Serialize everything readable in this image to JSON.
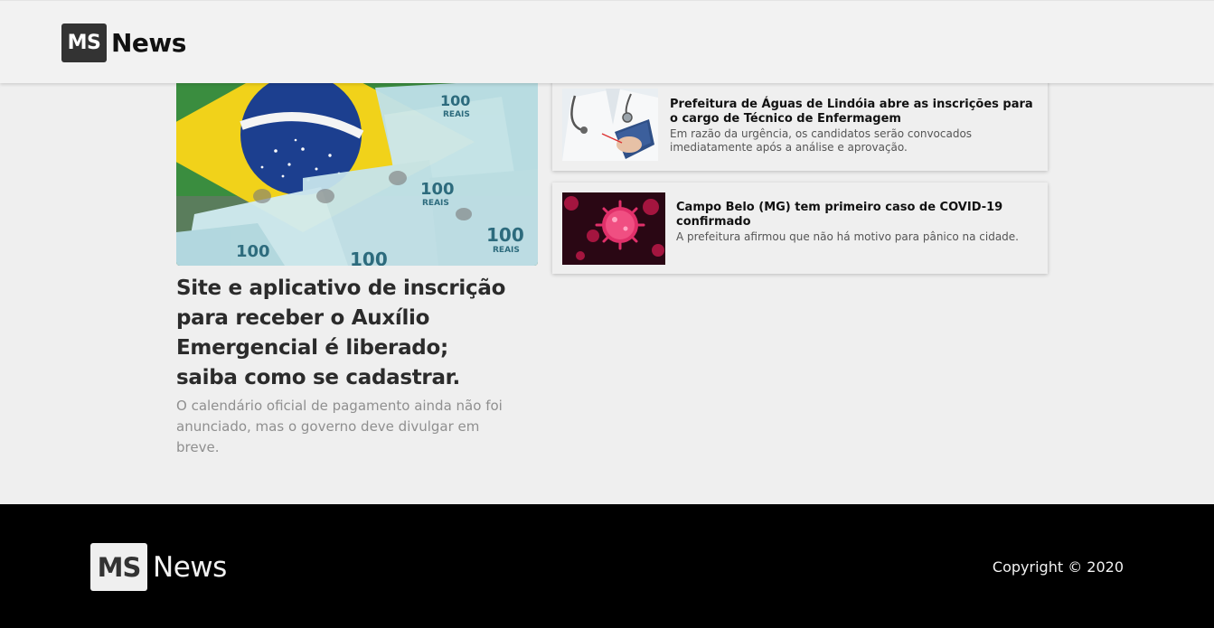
{
  "header": {
    "logo_badge": "MS",
    "logo_word": "News"
  },
  "featured": {
    "image_description": "brazil-flag-with-real-banknotes",
    "title": "Site e aplicativo de inscrição para receber o Auxílio Emergencial é liberado; saiba como se cadastrar.",
    "summary": "O calendário oficial de pagamento ainda não foi anunciado, mas o governo deve divulgar em breve."
  },
  "cards": [
    {
      "image_description": "doctor-with-stethoscope-and-clipboard",
      "title": "Prefeitura de Águas de Lindóia abre as inscrições para o cargo de Técnico de Enfermagem",
      "summary": "Em razão da urgência, os candidatos serão convocados imediatamente após a análise e aprovação."
    },
    {
      "image_description": "coronavirus-particles-illustration",
      "title": "Campo Belo (MG) tem primeiro caso de COVID-19 confirmado",
      "summary": "A prefeitura afirmou que não há motivo para pânico na cidade."
    }
  ],
  "footer": {
    "logo_badge": "MS",
    "logo_word": "News",
    "copyright": "Copyright © 2020"
  },
  "colors": {
    "page_background": "#efefef",
    "footer_background": "#000000",
    "logo_badge": "#333333"
  }
}
